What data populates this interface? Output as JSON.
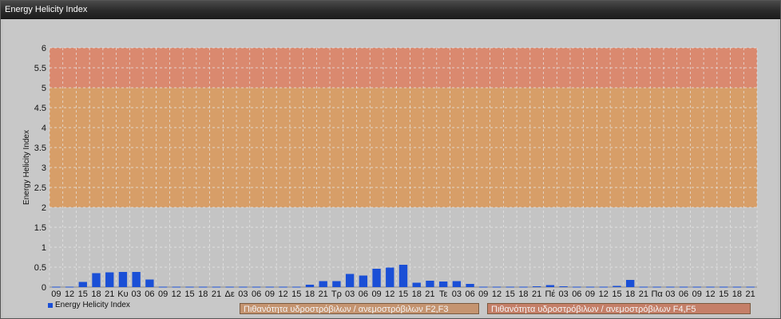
{
  "window": {
    "title": "Energy Helicity Index"
  },
  "chart_data": {
    "type": "bar",
    "ylabel": "Energy Helicity Index",
    "ylim": [
      0,
      6
    ],
    "yticks": [
      "0",
      "0.5",
      "1",
      "1.5",
      "2",
      "2.5",
      "3",
      "3.5",
      "4",
      "4.5",
      "5",
      "5.5",
      "6"
    ],
    "categories": [
      "09",
      "12",
      "15",
      "18",
      "21",
      "Κυ",
      "03",
      "06",
      "09",
      "12",
      "15",
      "18",
      "21",
      "Δε",
      "03",
      "06",
      "09",
      "12",
      "15",
      "18",
      "21",
      "Τρ",
      "03",
      "06",
      "09",
      "12",
      "15",
      "18",
      "21",
      "Τε",
      "03",
      "06",
      "09",
      "12",
      "15",
      "18",
      "21",
      "Πέ",
      "03",
      "06",
      "09",
      "12",
      "15",
      "18",
      "21",
      "Πα",
      "03",
      "06",
      "09",
      "12",
      "15",
      "18",
      "21"
    ],
    "series": [
      {
        "name": "Energy Helicity Index",
        "color": "#1a4fd6",
        "values": [
          0.01,
          0.01,
          0.13,
          0.35,
          0.37,
          0.38,
          0.38,
          0.19,
          0.01,
          0.01,
          0.01,
          0.01,
          0.01,
          0.01,
          0.01,
          0.01,
          0.01,
          0.01,
          0.01,
          0.06,
          0.15,
          0.15,
          0.33,
          0.29,
          0.46,
          0.49,
          0.56,
          0.11,
          0.16,
          0.14,
          0.15,
          0.08,
          0.01,
          0.01,
          0.01,
          0.01,
          0.02,
          0.05,
          0.02,
          0.01,
          0.01,
          0.01,
          0.03,
          0.18,
          0.01,
          0.01,
          0.01,
          0.01,
          0.01,
          0.01,
          0.01,
          0.01,
          0.01
        ]
      }
    ],
    "bands": [
      {
        "name": "Πιθανότητα υδροστρόβιλων / ανεμοστρόβιλων F2,F3",
        "from": 2,
        "to": 5,
        "color": "#d99a5e"
      },
      {
        "name": "Πιθανότητα υδροστρόβιλων / ανεμοστρόβιλων F4,F5",
        "from": 5,
        "to": 6,
        "color": "#dd8366"
      }
    ],
    "grid": true,
    "legend_placement": "bottom"
  }
}
